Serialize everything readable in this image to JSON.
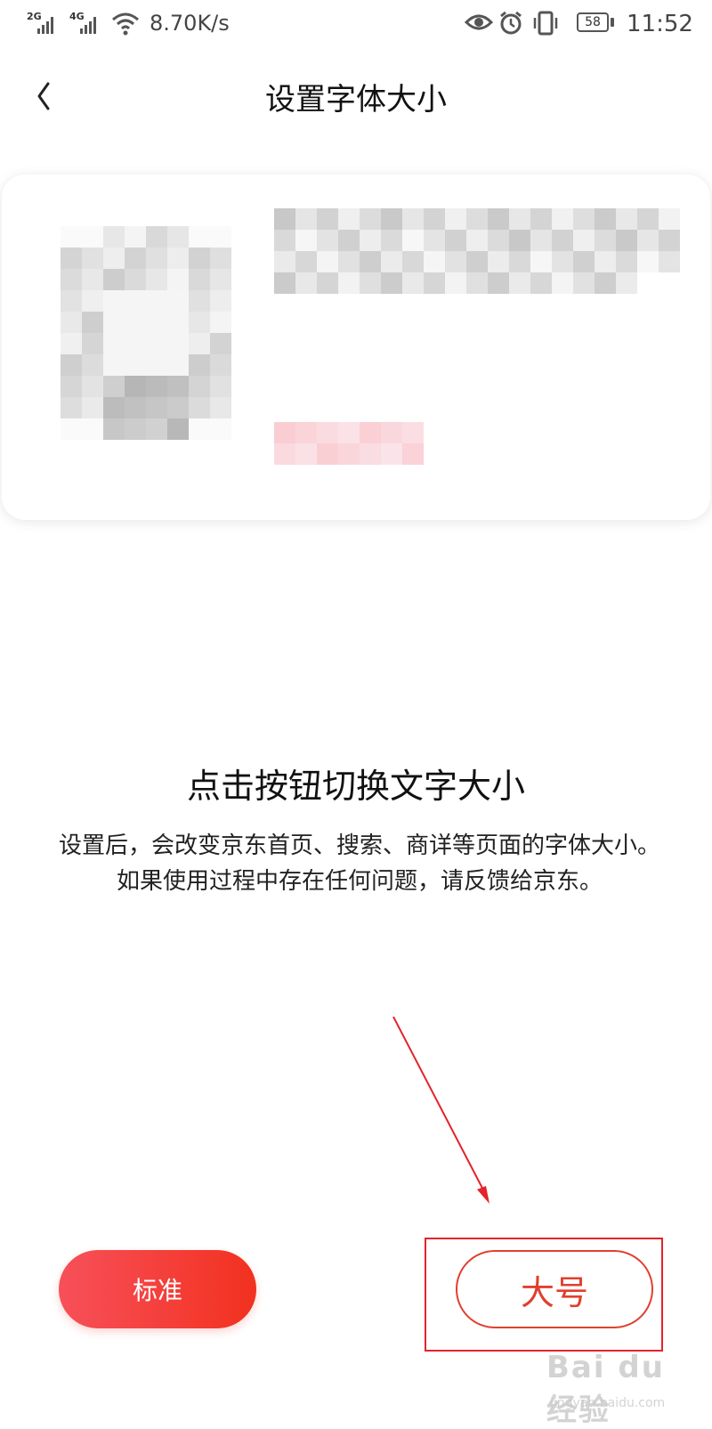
{
  "status_bar": {
    "network_1": "2G",
    "network_2": "4G",
    "speed": "8.70K/s",
    "battery": "58",
    "time": "11:52",
    "icons": [
      "signal-icon",
      "signal-icon",
      "wifi-icon",
      "eye-icon",
      "alarm-icon",
      "vibrate-icon",
      "battery-icon"
    ]
  },
  "header": {
    "title": "设置字体大小",
    "back_icon": "back-chevron-icon"
  },
  "preview": {
    "avatar_label": "pixelated avatar",
    "name_label": "pixelated text"
  },
  "info": {
    "title": "点击按钮切换文字大小",
    "body": "设置后，会改变京东首页、搜索、商详等页面的字体大小。如果使用过程中存在任何问题，请反馈给京东。"
  },
  "buttons": {
    "standard_label": "标准",
    "large_label": "大号"
  },
  "watermark": {
    "brand": "Bai du 经验",
    "url": "jingyan.baidu.com"
  },
  "colors": {
    "accent": "#f2311f",
    "accent_light": "#f7505a",
    "annotation": "#e4232a"
  }
}
